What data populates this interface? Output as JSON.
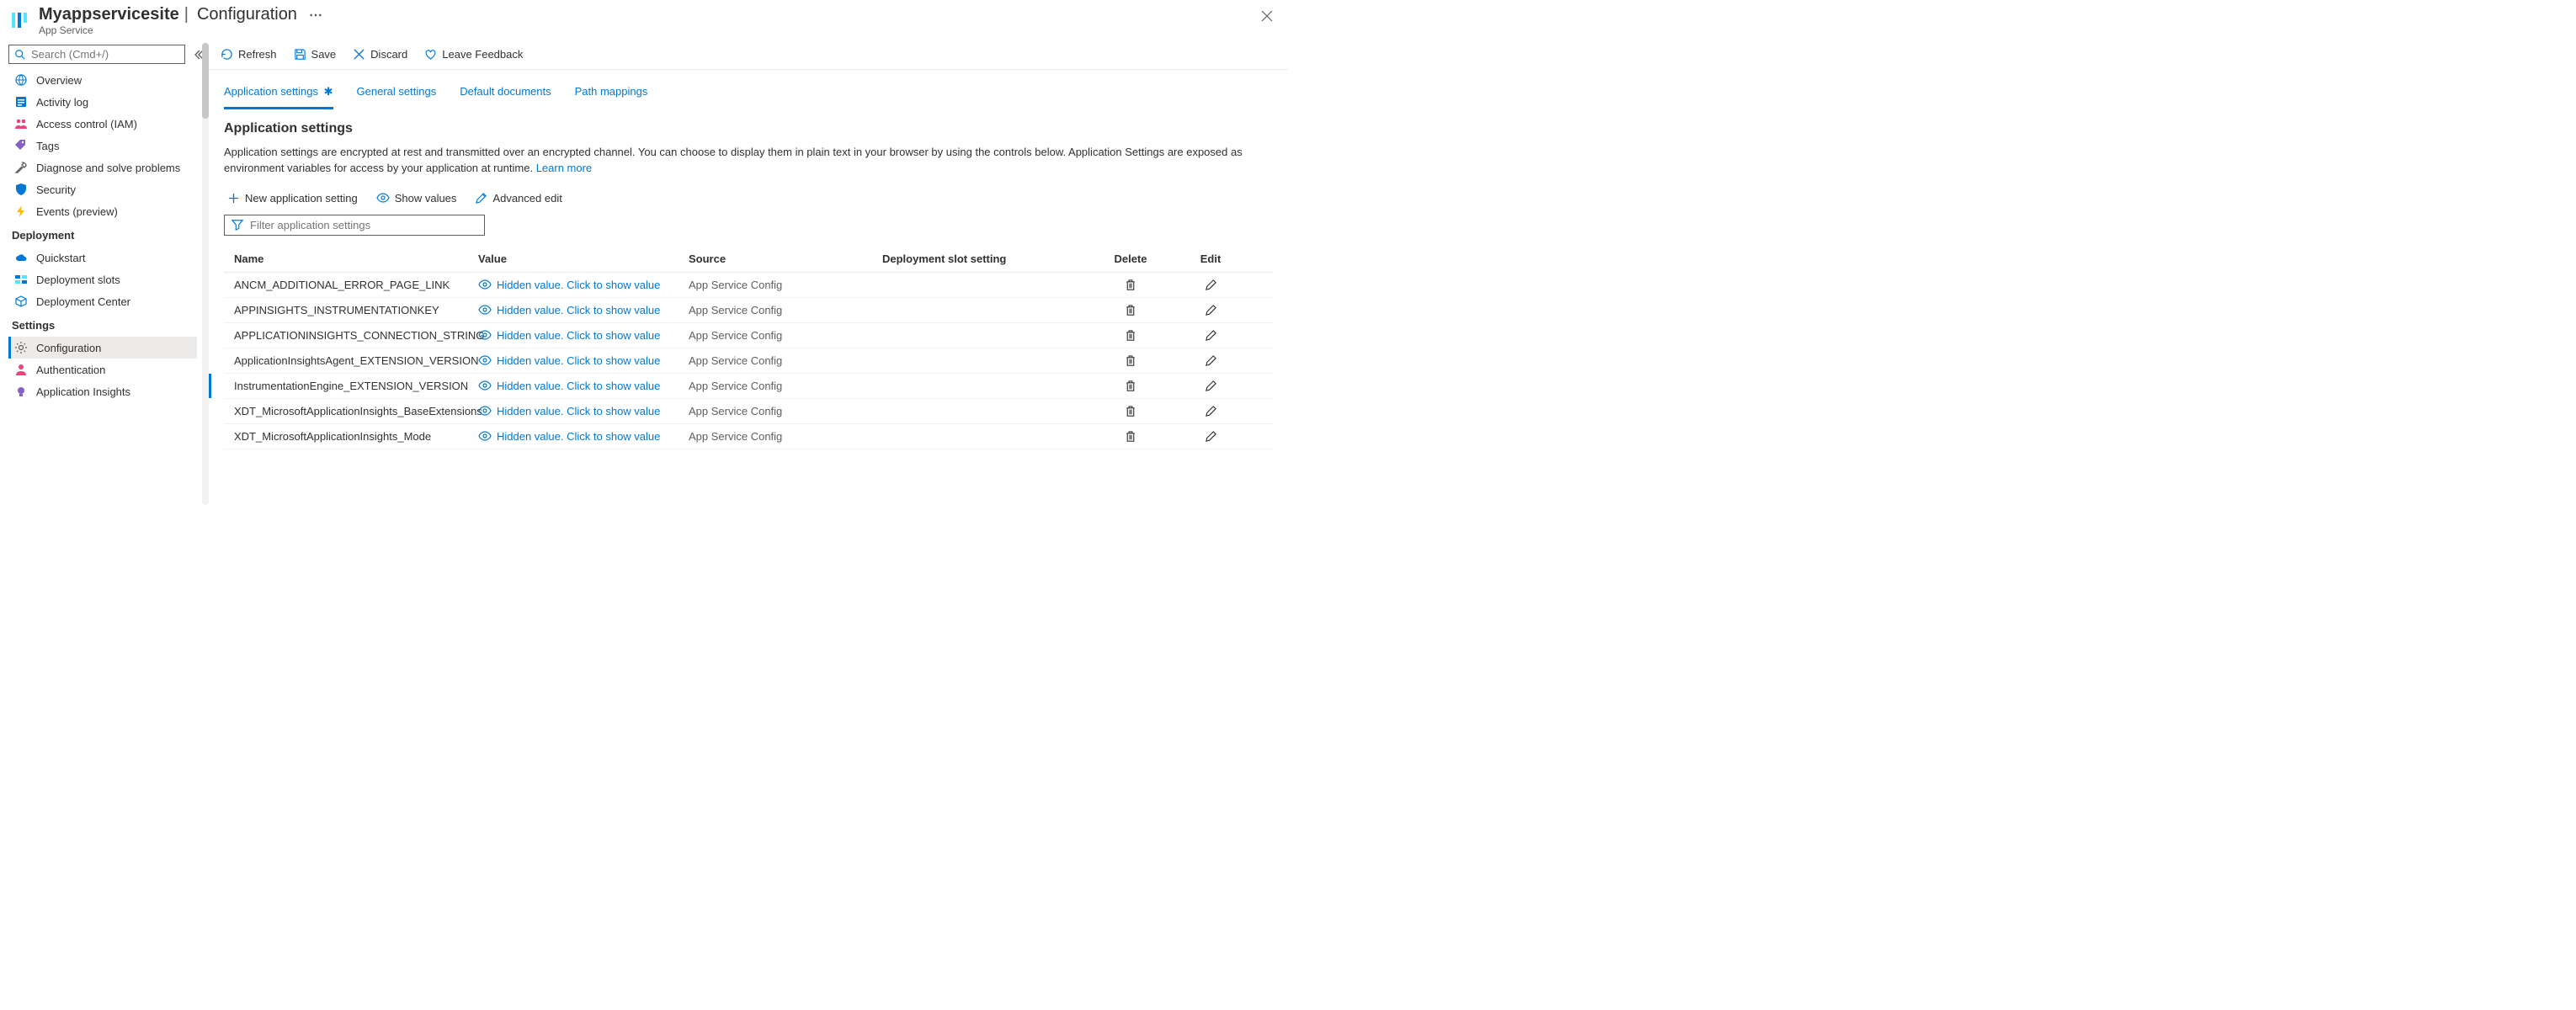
{
  "header": {
    "app_name": "Myappservicesite",
    "page_title": "Configuration",
    "subtitle": "App Service"
  },
  "search": {
    "placeholder": "Search (Cmd+/)"
  },
  "nav": {
    "top": [
      {
        "label": "Overview",
        "icon": "globe"
      },
      {
        "label": "Activity log",
        "icon": "log"
      },
      {
        "label": "Access control (IAM)",
        "icon": "people"
      },
      {
        "label": "Tags",
        "icon": "tag"
      },
      {
        "label": "Diagnose and solve problems",
        "icon": "wrench"
      },
      {
        "label": "Security",
        "icon": "shield"
      },
      {
        "label": "Events (preview)",
        "icon": "bolt"
      }
    ],
    "deployment_title": "Deployment",
    "deployment": [
      {
        "label": "Quickstart",
        "icon": "cloud"
      },
      {
        "label": "Deployment slots",
        "icon": "slots"
      },
      {
        "label": "Deployment Center",
        "icon": "box"
      }
    ],
    "settings_title": "Settings",
    "settings": [
      {
        "label": "Configuration",
        "icon": "gear",
        "selected": true
      },
      {
        "label": "Authentication",
        "icon": "person"
      },
      {
        "label": "Application Insights",
        "icon": "bulb"
      }
    ]
  },
  "cmdbar": {
    "refresh": "Refresh",
    "save": "Save",
    "discard": "Discard",
    "feedback": "Leave Feedback"
  },
  "tabs": [
    {
      "label": "Application settings",
      "active": true,
      "dirty": true
    },
    {
      "label": "General settings"
    },
    {
      "label": "Default documents"
    },
    {
      "label": "Path mappings"
    }
  ],
  "section": {
    "title": "Application settings",
    "desc": "Application settings are encrypted at rest and transmitted over an encrypted channel. You can choose to display them in plain text in your browser by using the controls below. Application Settings are exposed as environment variables for access by your application at runtime. ",
    "learn_more": "Learn more"
  },
  "secondary": {
    "new": "New application setting",
    "show": "Show values",
    "advanced": "Advanced edit"
  },
  "filter": {
    "placeholder": "Filter application settings"
  },
  "table": {
    "headers": {
      "name": "Name",
      "value": "Value",
      "source": "Source",
      "slot": "Deployment slot setting",
      "delete": "Delete",
      "edit": "Edit"
    },
    "hidden_text": "Hidden value. Click to show value",
    "rows": [
      {
        "name": "ANCM_ADDITIONAL_ERROR_PAGE_LINK",
        "source": "App Service Config"
      },
      {
        "name": "APPINSIGHTS_INSTRUMENTATIONKEY",
        "source": "App Service Config"
      },
      {
        "name": "APPLICATIONINSIGHTS_CONNECTION_STRING",
        "source": "App Service Config"
      },
      {
        "name": "ApplicationInsightsAgent_EXTENSION_VERSION",
        "source": "App Service Config"
      },
      {
        "name": "InstrumentationEngine_EXTENSION_VERSION",
        "source": "App Service Config",
        "sel": true
      },
      {
        "name": "XDT_MicrosoftApplicationInsights_BaseExtensions",
        "source": "App Service Config"
      },
      {
        "name": "XDT_MicrosoftApplicationInsights_Mode",
        "source": "App Service Config"
      }
    ]
  }
}
